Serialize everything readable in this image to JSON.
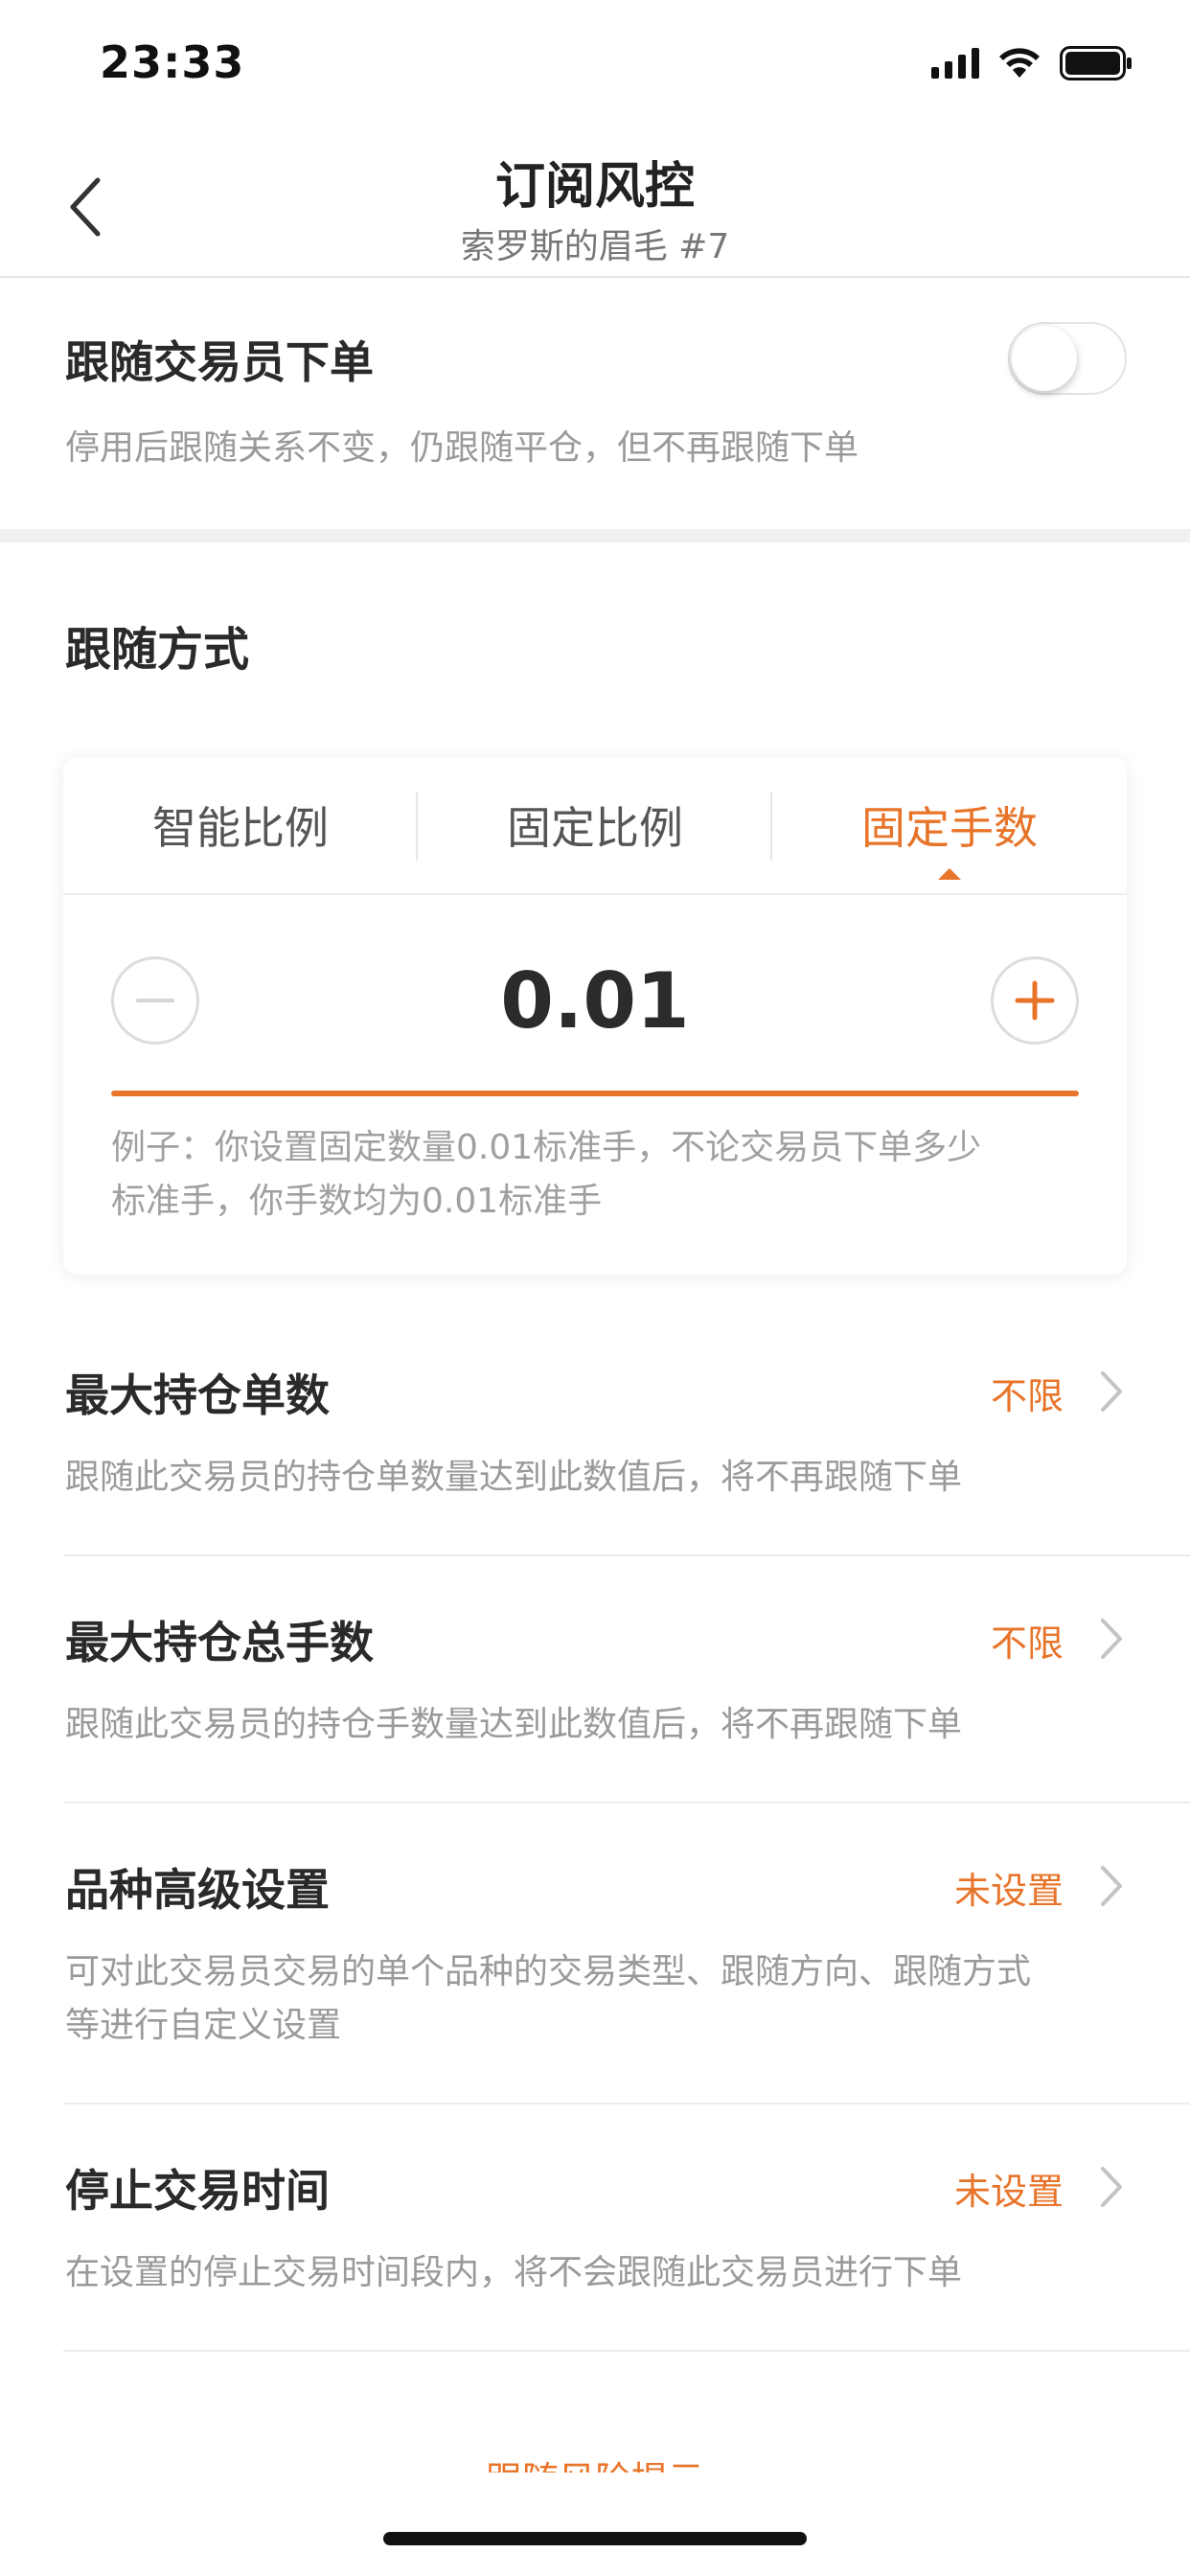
{
  "status_bar": {
    "time": "23:33"
  },
  "nav": {
    "title": "订阅风控",
    "subtitle": "索罗斯的眉毛 #7"
  },
  "follow_order": {
    "title": "跟随交易员下单",
    "description": "停用后跟随关系不变，仍跟随平仓，但不再跟随下单",
    "enabled": false
  },
  "follow_mode": {
    "title": "跟随方式",
    "tabs": [
      "智能比例",
      "固定比例",
      "固定手数"
    ],
    "active_tab": 2,
    "stepper_value": "0.01",
    "example_line1": "例子：你设置固定数量0.01标准手，不论交易员下单多少",
    "example_line2": "标准手，你手数均为0.01标准手"
  },
  "settings": [
    {
      "title": "最大持仓单数",
      "value": "不限",
      "desc1": "跟随此交易员的持仓单数量达到此数值后，将不再跟随下单",
      "desc2": ""
    },
    {
      "title": "最大持仓总手数",
      "value": "不限",
      "desc1": "跟随此交易员的持仓手数量达到此数值后，将不再跟随下单",
      "desc2": ""
    },
    {
      "title": "品种高级设置",
      "value": "未设置",
      "desc1": "可对此交易员交易的单个品种的交易类型、跟随方向、跟随方式",
      "desc2": "等进行自定义设置"
    },
    {
      "title": "停止交易时间",
      "value": "未设置",
      "desc1": "在设置的停止交易时间段内，将不会跟随此交易员进行下单",
      "desc2": ""
    }
  ],
  "bottom_link": "跟随风险提示",
  "colors": {
    "accent": "#e8742a",
    "text_primary": "#2a2a2a",
    "text_secondary": "#9a9a9a"
  },
  "icons": {
    "back": "chevron-left-icon",
    "row_arrow": "chevron-right-icon",
    "minus": "minus-circle-icon",
    "plus": "plus-circle-icon"
  }
}
